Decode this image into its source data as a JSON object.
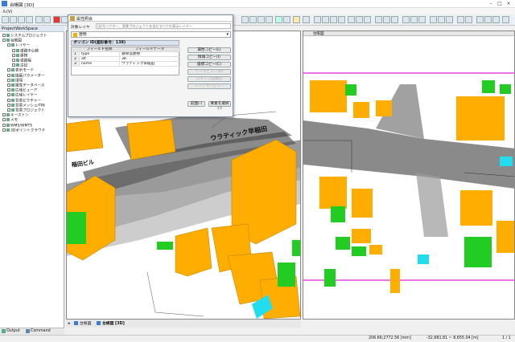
{
  "app": {
    "title": "台帳図 [3D]"
  },
  "menu": {
    "first": "ル(V)"
  },
  "left_panel": {
    "header": "ProjectWorkSpace",
    "tree": [
      {
        "label": "システムプロジェクト",
        "indent": 0
      },
      {
        "label": "台帳図",
        "indent": 0
      },
      {
        "label": "レイヤー",
        "indent": 1
      },
      {
        "label": "道路中心線",
        "indent": 2
      },
      {
        "label": "建物",
        "indent": 2
      },
      {
        "label": "道路幅",
        "indent": 2
      },
      {
        "label": "注記",
        "indent": 2
      },
      {
        "label": "表示モード",
        "indent": 1
      },
      {
        "label": "描画パラメーター",
        "indent": 1
      },
      {
        "label": "環境",
        "indent": 1
      },
      {
        "label": "属性データベース",
        "indent": 1
      },
      {
        "label": "広域ビューア",
        "indent": 1
      },
      {
        "label": "広域レイヤー",
        "indent": 1
      },
      {
        "label": "背景ビクチャー",
        "indent": 1
      },
      {
        "label": "背景メッシュ/TIN",
        "indent": 1
      },
      {
        "label": "背景プロジェクト",
        "indent": 1
      },
      {
        "label": "キーストン",
        "indent": 0
      },
      {
        "label": "メモ",
        "indent": 0
      },
      {
        "label": "WMS/WMTS",
        "indent": 0
      },
      {
        "label": "3Dポイントクラウド",
        "indent": 0
      }
    ],
    "bottom_tabs": [
      "Output",
      "Command"
    ]
  },
  "attr_window": {
    "title": "属性照会",
    "target_layer_label": "対象レイヤ",
    "layer_search_placeholder": "(記号ベクター、背景プロジェクトを含むすべての表示レイヤー",
    "selected_layer": "建物",
    "object_header": "ポリゴン ID(図形番号：138)",
    "table_headers": [
      "フィールド名称",
      "フィールドデータ"
    ],
    "rows": [
      {
        "no": "1",
        "name": "type",
        "value": "鉄骨造建物"
      },
      {
        "no": "2",
        "name": "alt",
        "value": "38"
      },
      {
        "no": "3",
        "name": "name",
        "value": "ウラティック早稲田"
      }
    ],
    "buttons": [
      "属性コピー(L)",
      "情報コピー(I)",
      "座標コピー(C)",
      "データピュー(D)",
      "ジャンプ記録(J)",
      "レイアウトピュー"
    ],
    "footer_buttons": [
      "前面(-)",
      "要素を選択(-)"
    ]
  },
  "map_left": {
    "tab_label": "台帳図",
    "map_labels": [
      "ウラティック早稲田",
      "稲田ビル"
    ]
  },
  "map_right": {
    "tab_label": "台帳図"
  },
  "map_tabs": [
    "台帳図",
    "台帳図 [3D]"
  ],
  "status": {
    "coords1": "206.66;2772.56 [mm]",
    "coords2": "-32,681.81 ~ 8,655.04 [m]",
    "page": "1 / 1"
  },
  "colors": {
    "building": "#ffae00",
    "green": "#22cc22",
    "cyan": "#22ddee",
    "magenta": "#dd22dd",
    "selection": "#0058b0"
  }
}
